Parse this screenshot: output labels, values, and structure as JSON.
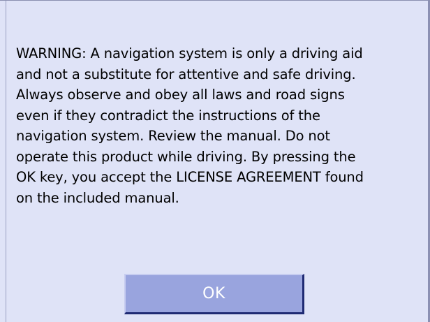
{
  "dialog": {
    "warning_text": "WARNING: A navigation system is only a driving aid\nand not a substitute for attentive and safe driving.\nAlways observe and obey all laws and road signs\neven if they contradict the instructions of the\nnavigation system. Review the manual. Do not\noperate this product while driving. By pressing the\nOK key, you accept the LICENSE AGREEMENT found\non the included manual.",
    "ok_label": "OK"
  },
  "colors": {
    "background": "#dfe3f7",
    "button_face": "#99a4de",
    "button_shadow": "#1f2a73",
    "button_text": "#ffffff"
  }
}
